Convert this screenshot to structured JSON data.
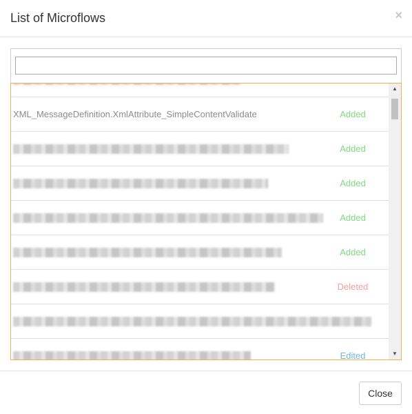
{
  "modal": {
    "title": "List of Microflows",
    "close_icon": "×",
    "close_button_label": "Close"
  },
  "search": {
    "value": "",
    "placeholder": ""
  },
  "list": {
    "rows": [
      {
        "name": "",
        "status": ""
      },
      {
        "name": "XML_MessageDefinition.XmlAttribute_SimpleContentValidate",
        "status": "Added"
      },
      {
        "name": "",
        "status": "Added"
      },
      {
        "name": "",
        "status": "Added"
      },
      {
        "name": "",
        "status": "Added"
      },
      {
        "name": "",
        "status": "Added"
      },
      {
        "name": "",
        "status": "Deleted"
      },
      {
        "name": "",
        "status": ""
      },
      {
        "name": "",
        "status": "Edited"
      }
    ]
  },
  "colors": {
    "added": "#7ddc7d",
    "deleted": "#f0a0a0",
    "edited": "#6fb6e6",
    "list_border": "#f0b04e"
  },
  "icons": {
    "close": "close-icon",
    "scroll_up": "arrow-up-icon",
    "scroll_down": "arrow-down-icon"
  }
}
